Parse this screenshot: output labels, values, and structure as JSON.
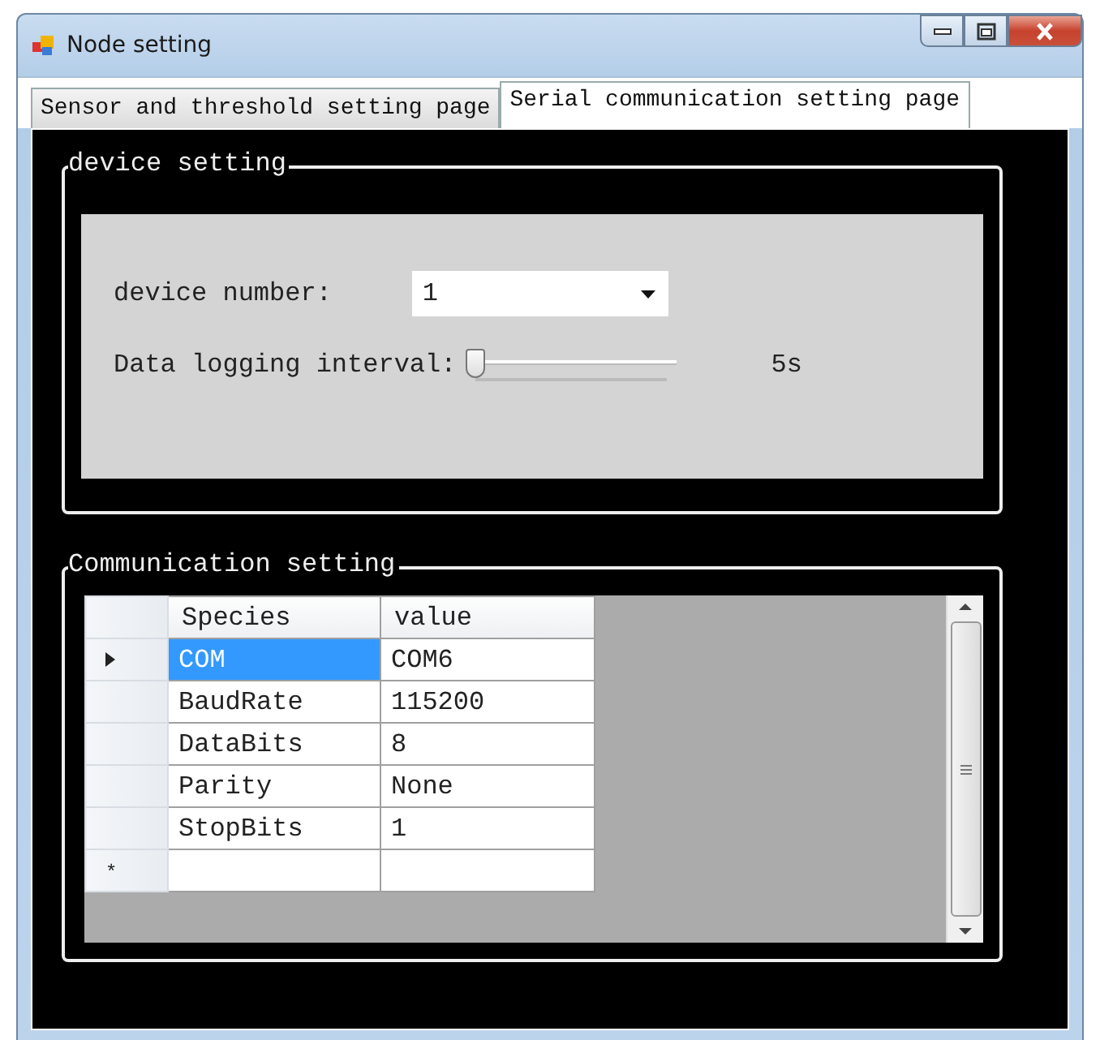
{
  "window": {
    "title": "Node setting"
  },
  "tabs": [
    {
      "label": "Sensor and threshold setting page",
      "selected": false
    },
    {
      "label": "Serial communication setting page",
      "selected": true
    }
  ],
  "device_setting": {
    "title": "device setting",
    "device_number_label": "device number:",
    "device_number_value": "1",
    "interval_label": "Data logging interval:",
    "interval_slider": {
      "level": 0
    },
    "interval_reading": "5s"
  },
  "communication_setting": {
    "title": "Communication setting",
    "columns": [
      "Species",
      "value"
    ],
    "rows": [
      {
        "cells": [
          "COM",
          "COM6"
        ],
        "selected": true
      },
      {
        "cells": [
          "BaudRate",
          "115200"
        ],
        "selected": false
      },
      {
        "cells": [
          "DataBits",
          "8"
        ],
        "selected": false
      },
      {
        "cells": [
          "Parity",
          "None"
        ],
        "selected": false
      },
      {
        "cells": [
          "StopBits",
          "1"
        ],
        "selected": false
      }
    ],
    "new_row_marker": "*"
  }
}
